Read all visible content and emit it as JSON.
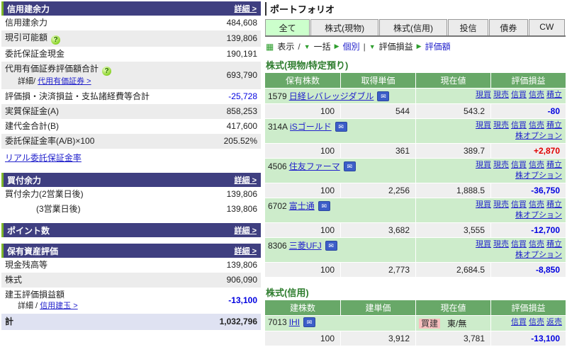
{
  "colors": {
    "header_navy": "#3f3f80",
    "accent_green": "#7db629",
    "link_blue": "#2222cc",
    "negative_blue": "#0000e0",
    "positive_red": "#e00000",
    "table_header_green": "#68a868",
    "name_row_green": "#cdeccb",
    "active_tab_green": "#ccffcc",
    "total_row_lavender": "#dfe2f2"
  },
  "icons": {
    "mail": "✉",
    "help": "?",
    "table": "▦",
    "tri_down": "▼",
    "tri_right": "▶"
  },
  "left": {
    "margin_power": {
      "title": "信用建余力",
      "detail": "詳細 >",
      "rows": {
        "shinyo": {
          "label": "信用建余力",
          "value": "484,608"
        },
        "genbiki": {
          "label": "現引可能額",
          "value": "139,806"
        },
        "itaku_cash": {
          "label": "委託保証金現金",
          "value": "190,191"
        },
        "daiyo": {
          "label": "代用有価証券評価額合計",
          "sub_prefix": "詳細/",
          "sub_link": "代用有価証券 >",
          "value": "693,790"
        },
        "hyokason": {
          "label": "評価損・決済損益・支払諸経費等合計",
          "value": "-25,728"
        },
        "jisshitsu": {
          "label": "実質保証金(A)",
          "value": "858,253"
        },
        "tatedai": {
          "label": "建代金合計(B)",
          "value": "417,600"
        },
        "ritsu": {
          "label": "委託保証金率(A/B)×100",
          "value": "205.52%"
        },
        "real_link": "リアル委託保証金率"
      }
    },
    "buying_power": {
      "title": "買付余力",
      "detail": "詳細 >",
      "rows": {
        "d2": {
          "label": "買付余力(2営業日後)",
          "value": "139,806"
        },
        "d3": {
          "label": "(3営業日後)",
          "value": "139,806"
        }
      }
    },
    "points": {
      "title": "ポイント数",
      "detail": "詳細 >"
    },
    "assets": {
      "title": "保有資産評価",
      "detail": "詳細 >",
      "rows": {
        "cash": {
          "label": "現金残高等",
          "value": "139,806"
        },
        "stocks": {
          "label": "株式",
          "value": "906,090"
        },
        "tategyoku": {
          "label": "建玉評価損益額",
          "sub_prefix": "詳細 /",
          "sub_link": "信用建玉 >",
          "value": "-13,100"
        },
        "total": {
          "label": "計",
          "value": "1,032,796"
        }
      }
    }
  },
  "right": {
    "title": "ポートフォリオ",
    "tabs": [
      "全て",
      "株式(現物)",
      "株式(信用)",
      "投信",
      "債券",
      "CW"
    ],
    "toolbar": {
      "hyouji": "表示",
      "sep_slash": "/",
      "ikkatsu": "一括",
      "kobetsu": "個別",
      "sep_pipe": "|",
      "hyoka_soneki": "評価損益",
      "hyokagaku": "評価額"
    },
    "trade_links": {
      "genbuy": "現買",
      "gensell": "現売",
      "shinbuy": "信買",
      "shinsell": "信売",
      "tsumitate": "積立",
      "kabu_option": "株オプション",
      "hensai": "返売"
    },
    "spot": {
      "title": "株式(現物/特定預り)",
      "headers": [
        "保有株数",
        "取得単価",
        "現在値",
        "評価損益"
      ],
      "stocks": [
        {
          "code": "1579",
          "name": "日経レバレッジダブル",
          "qty": "100",
          "cost": "544",
          "price": "543.2",
          "pl": "-80"
        },
        {
          "code": "314A",
          "name": "iSゴールド",
          "qty": "100",
          "cost": "361",
          "price": "389.7",
          "pl": "+2,870"
        },
        {
          "code": "4506",
          "name": "住友ファーマ",
          "qty": "100",
          "cost": "2,256",
          "price": "1,888.5",
          "pl": "-36,750"
        },
        {
          "code": "6702",
          "name": "富士通",
          "qty": "100",
          "cost": "3,682",
          "price": "3,555",
          "pl": "-12,700"
        },
        {
          "code": "8306",
          "name": "三菱UFJ",
          "qty": "100",
          "cost": "2,773",
          "price": "2,684.5",
          "pl": "-8,850"
        }
      ]
    },
    "margin": {
      "title": "株式(信用)",
      "headers": [
        "建株数",
        "建単価",
        "現在値",
        "評価損益"
      ],
      "stock": {
        "code": "7013",
        "name": "IHI",
        "position_badge": "買建",
        "market": "東/無",
        "qty": "100",
        "cost": "3,912",
        "price": "3,781",
        "pl": "-13,100"
      }
    }
  }
}
